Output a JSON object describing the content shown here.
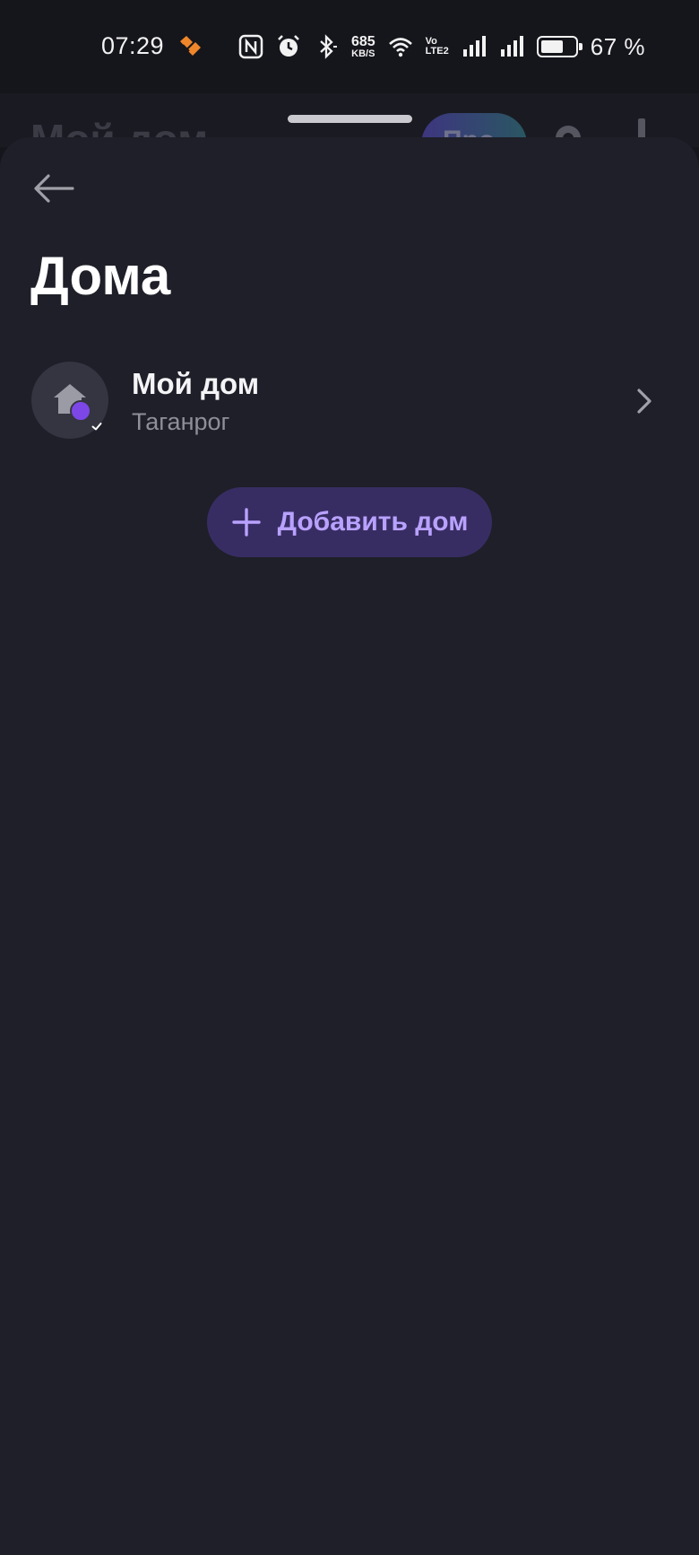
{
  "status_bar": {
    "time": "07:29",
    "net_speed_value": "685",
    "net_speed_unit": "KB/S",
    "volte_top": "Vo",
    "volte_bottom": "LTE2",
    "battery_percent_text": "67 %",
    "battery_level": 0.67
  },
  "background": {
    "title": "Мой дом",
    "pill_text": "Про"
  },
  "page": {
    "title": "Дома"
  },
  "homes": [
    {
      "name": "Мой дом",
      "city": "Таганрог"
    }
  ],
  "actions": {
    "add_home_label": "Добавить дом"
  },
  "colors": {
    "sheet_bg": "#1e1f28",
    "accent": "#7d47e8",
    "button_bg": "#382d63",
    "button_text": "#b9a2ff",
    "secondary_text": "#8e8f99"
  },
  "icons": {
    "back": "arrow-left-icon",
    "home": "house-icon",
    "badge": "check-badge-icon",
    "chevron": "chevron-right-icon",
    "add": "plus-icon"
  }
}
